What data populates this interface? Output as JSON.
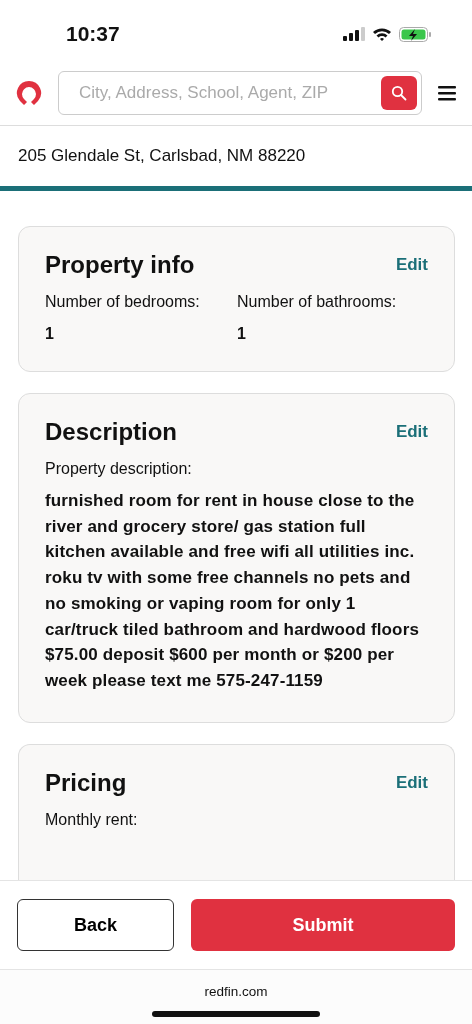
{
  "status_bar": {
    "time": "10:37"
  },
  "header": {
    "search": {
      "placeholder": "City, Address, School, Agent, ZIP"
    }
  },
  "address": "205 Glendale St, Carlsbad, NM 88220",
  "cards": [
    {
      "kind": "pair",
      "title": "Property info",
      "edit": "Edit",
      "fields": [
        {
          "label": "Number of bedrooms:",
          "value": "1"
        },
        {
          "label": "Number of bathrooms:",
          "value": "1"
        }
      ]
    },
    {
      "kind": "text",
      "title": "Description",
      "edit": "Edit",
      "label": "Property description:",
      "value": "furnished room for rent in house close to the river and grocery store/ gas station full kitchen available and free wifi all utilities inc. roku tv with some free channels no pets and no smoking or vaping room for only 1 car/truck tiled bathroom and hardwood floors $75.00 deposit $600 per month or $200 per week please text me 575-247-1159"
    },
    {
      "kind": "text",
      "title": "Pricing",
      "edit": "Edit",
      "label": "Monthly rent:"
    }
  ],
  "footer": {
    "back": "Back",
    "submit": "Submit"
  },
  "browser": {
    "url": "redfin.com"
  }
}
